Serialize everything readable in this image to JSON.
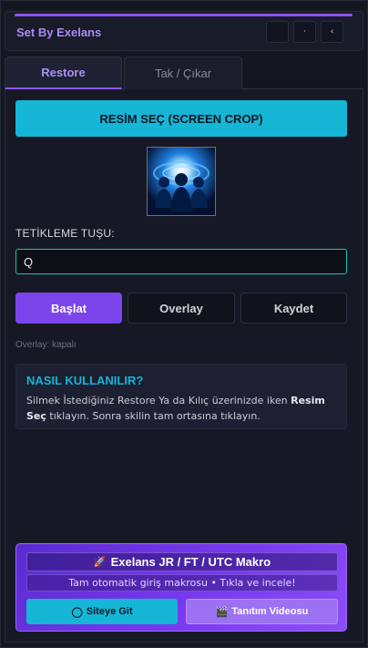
{
  "app": {
    "title": "Set By Exelans",
    "window_buttons": [
      "",
      "·",
      "‹"
    ]
  },
  "tabs": [
    {
      "label": "Restore",
      "active": true
    },
    {
      "label": "Tak / Çıkar",
      "active": false
    }
  ],
  "restore": {
    "select_button_label": "RESİM SEÇ (SCREEN CROP)",
    "preview_icon": "party-buff-icon",
    "key_label": "TETİKLEME TUŞU:",
    "key_value": "Q",
    "actions": {
      "start_label": "Başlat",
      "overlay_label": "Overlay",
      "save_label": "Kaydet"
    },
    "overlay_status": "Overlay: kapalı",
    "help": {
      "title": "NASIL KULLANILIR?",
      "text_1": "Silmek İstediğiniz Restore Ya da Kılıç üzerinizde iken ",
      "text_bold": "Resim Seç",
      "text_2": " tıklayın. Sonra skilin tam ortasına tıklayın."
    }
  },
  "promo": {
    "title": "Exelans JR / FT / UTC Makro",
    "title_icon": "rocket-icon",
    "subtitle": "Tam otomatik giriş makrosu • Tıkla ve incele!",
    "site_button_label": "Siteye Git",
    "site_button_icon": "globe-icon",
    "video_button_label": "Tanıtım Videosu",
    "video_button_icon": "clapper-icon"
  },
  "colors": {
    "accent_purple": "#8b57f1",
    "accent_cyan": "#16b6d6",
    "input_border": "#18c2b0",
    "background": "#141622"
  }
}
